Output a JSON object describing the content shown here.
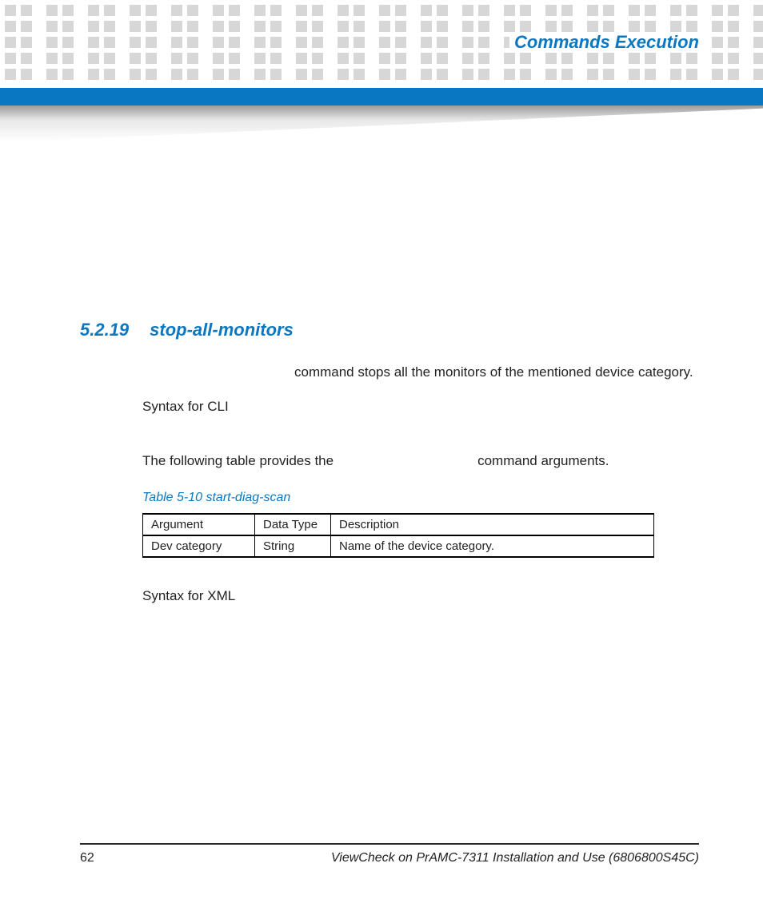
{
  "chapter_title": "Commands Execution",
  "section": {
    "number": "5.2.19",
    "title": "stop-all-monitors"
  },
  "paragraphs": {
    "p1_tail": "command stops all the monitors of the mentioned device category.",
    "p2": "Syntax for CLI",
    "p3_lead": "The following table provides the",
    "p3_tail": "command arguments.",
    "p4": "Syntax for XML"
  },
  "table": {
    "caption": "Table 5-10 start-diag-scan",
    "headers": [
      "Argument",
      "Data Type",
      "Description"
    ],
    "rows": [
      [
        "Dev category",
        "String",
        "Name of the device category."
      ]
    ]
  },
  "footer": {
    "page_number": "62",
    "doc_title": "ViewCheck on PrAMC-7311 Installation and Use (6806800S45C)"
  }
}
